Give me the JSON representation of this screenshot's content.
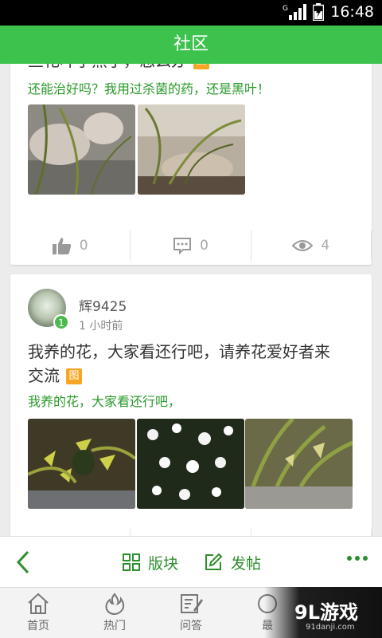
{
  "status_bar": {
    "time": "16:48",
    "network_label": "G"
  },
  "header": {
    "title": "社区"
  },
  "posts": [
    {
      "title": "兰花叶子黑了，怎么办",
      "image_tag": "图",
      "excerpt": "还能治好吗？我用过杀菌的药，还是黑叶！",
      "likes": "0",
      "comments": "0",
      "views": "4"
    },
    {
      "username": "辉9425",
      "user_level": "1",
      "time_ago": "1 小时前",
      "title_line1": "我养的花，大家看还行吧，请养花爱好者来",
      "title_line2": "交流",
      "image_tag": "图",
      "excerpt": "我养的花，大家看还行吧，"
    }
  ],
  "action_bar": {
    "sections_label": "版块",
    "compose_label": "发帖"
  },
  "tabs": [
    {
      "label": "首页",
      "icon": "home-icon"
    },
    {
      "label": "热门",
      "icon": "flame-icon"
    },
    {
      "label": "问答",
      "icon": "qa-icon"
    },
    {
      "label": "最",
      "icon": "latest-icon"
    }
  ],
  "watermark": {
    "logo": "9L游戏",
    "url": "91danji.com"
  },
  "colors": {
    "brand_green": "#3cc24d",
    "excerpt_green": "#2a9a2a",
    "tag_orange": "#f5a623"
  }
}
